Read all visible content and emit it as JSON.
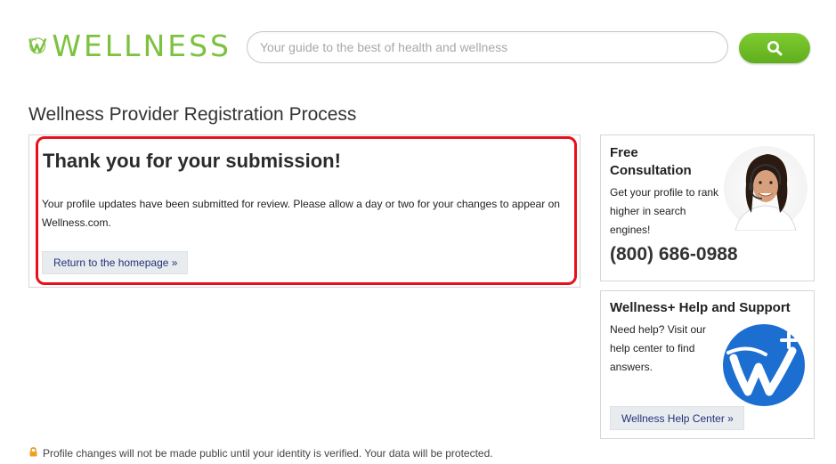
{
  "header": {
    "logo_text": "WELLNESS",
    "search_placeholder": "Your guide to the best of health and wellness"
  },
  "page": {
    "title": "Wellness Provider Registration Process"
  },
  "main": {
    "heading": "Thank you for your submission!",
    "message": "Your profile updates have been submitted for review. Please allow a day or two for your changes to appear on Wellness.com.",
    "button_label": "Return to the homepage »"
  },
  "sidebar": {
    "consultation": {
      "title": "Free Consultation",
      "text": "Get your profile to rank higher in search engines!",
      "phone": "(800) 686-0988"
    },
    "support": {
      "title": "Wellness+ Help and Support",
      "text": "Need help? Visit our help center to find answers.",
      "button_label": "Wellness Help Center »"
    }
  },
  "footer": {
    "note": "Profile changes will not be made public until your identity is verified. Your data will be protected."
  },
  "colors": {
    "brand_green": "#7cc23f",
    "highlight_red": "#e8101a",
    "link_blue": "#20327a",
    "logo_blue": "#1c6fd1"
  },
  "icons": [
    "wellness-logo-icon",
    "search-icon",
    "support-agent-avatar",
    "wellness-plus-icon",
    "lock-icon"
  ]
}
